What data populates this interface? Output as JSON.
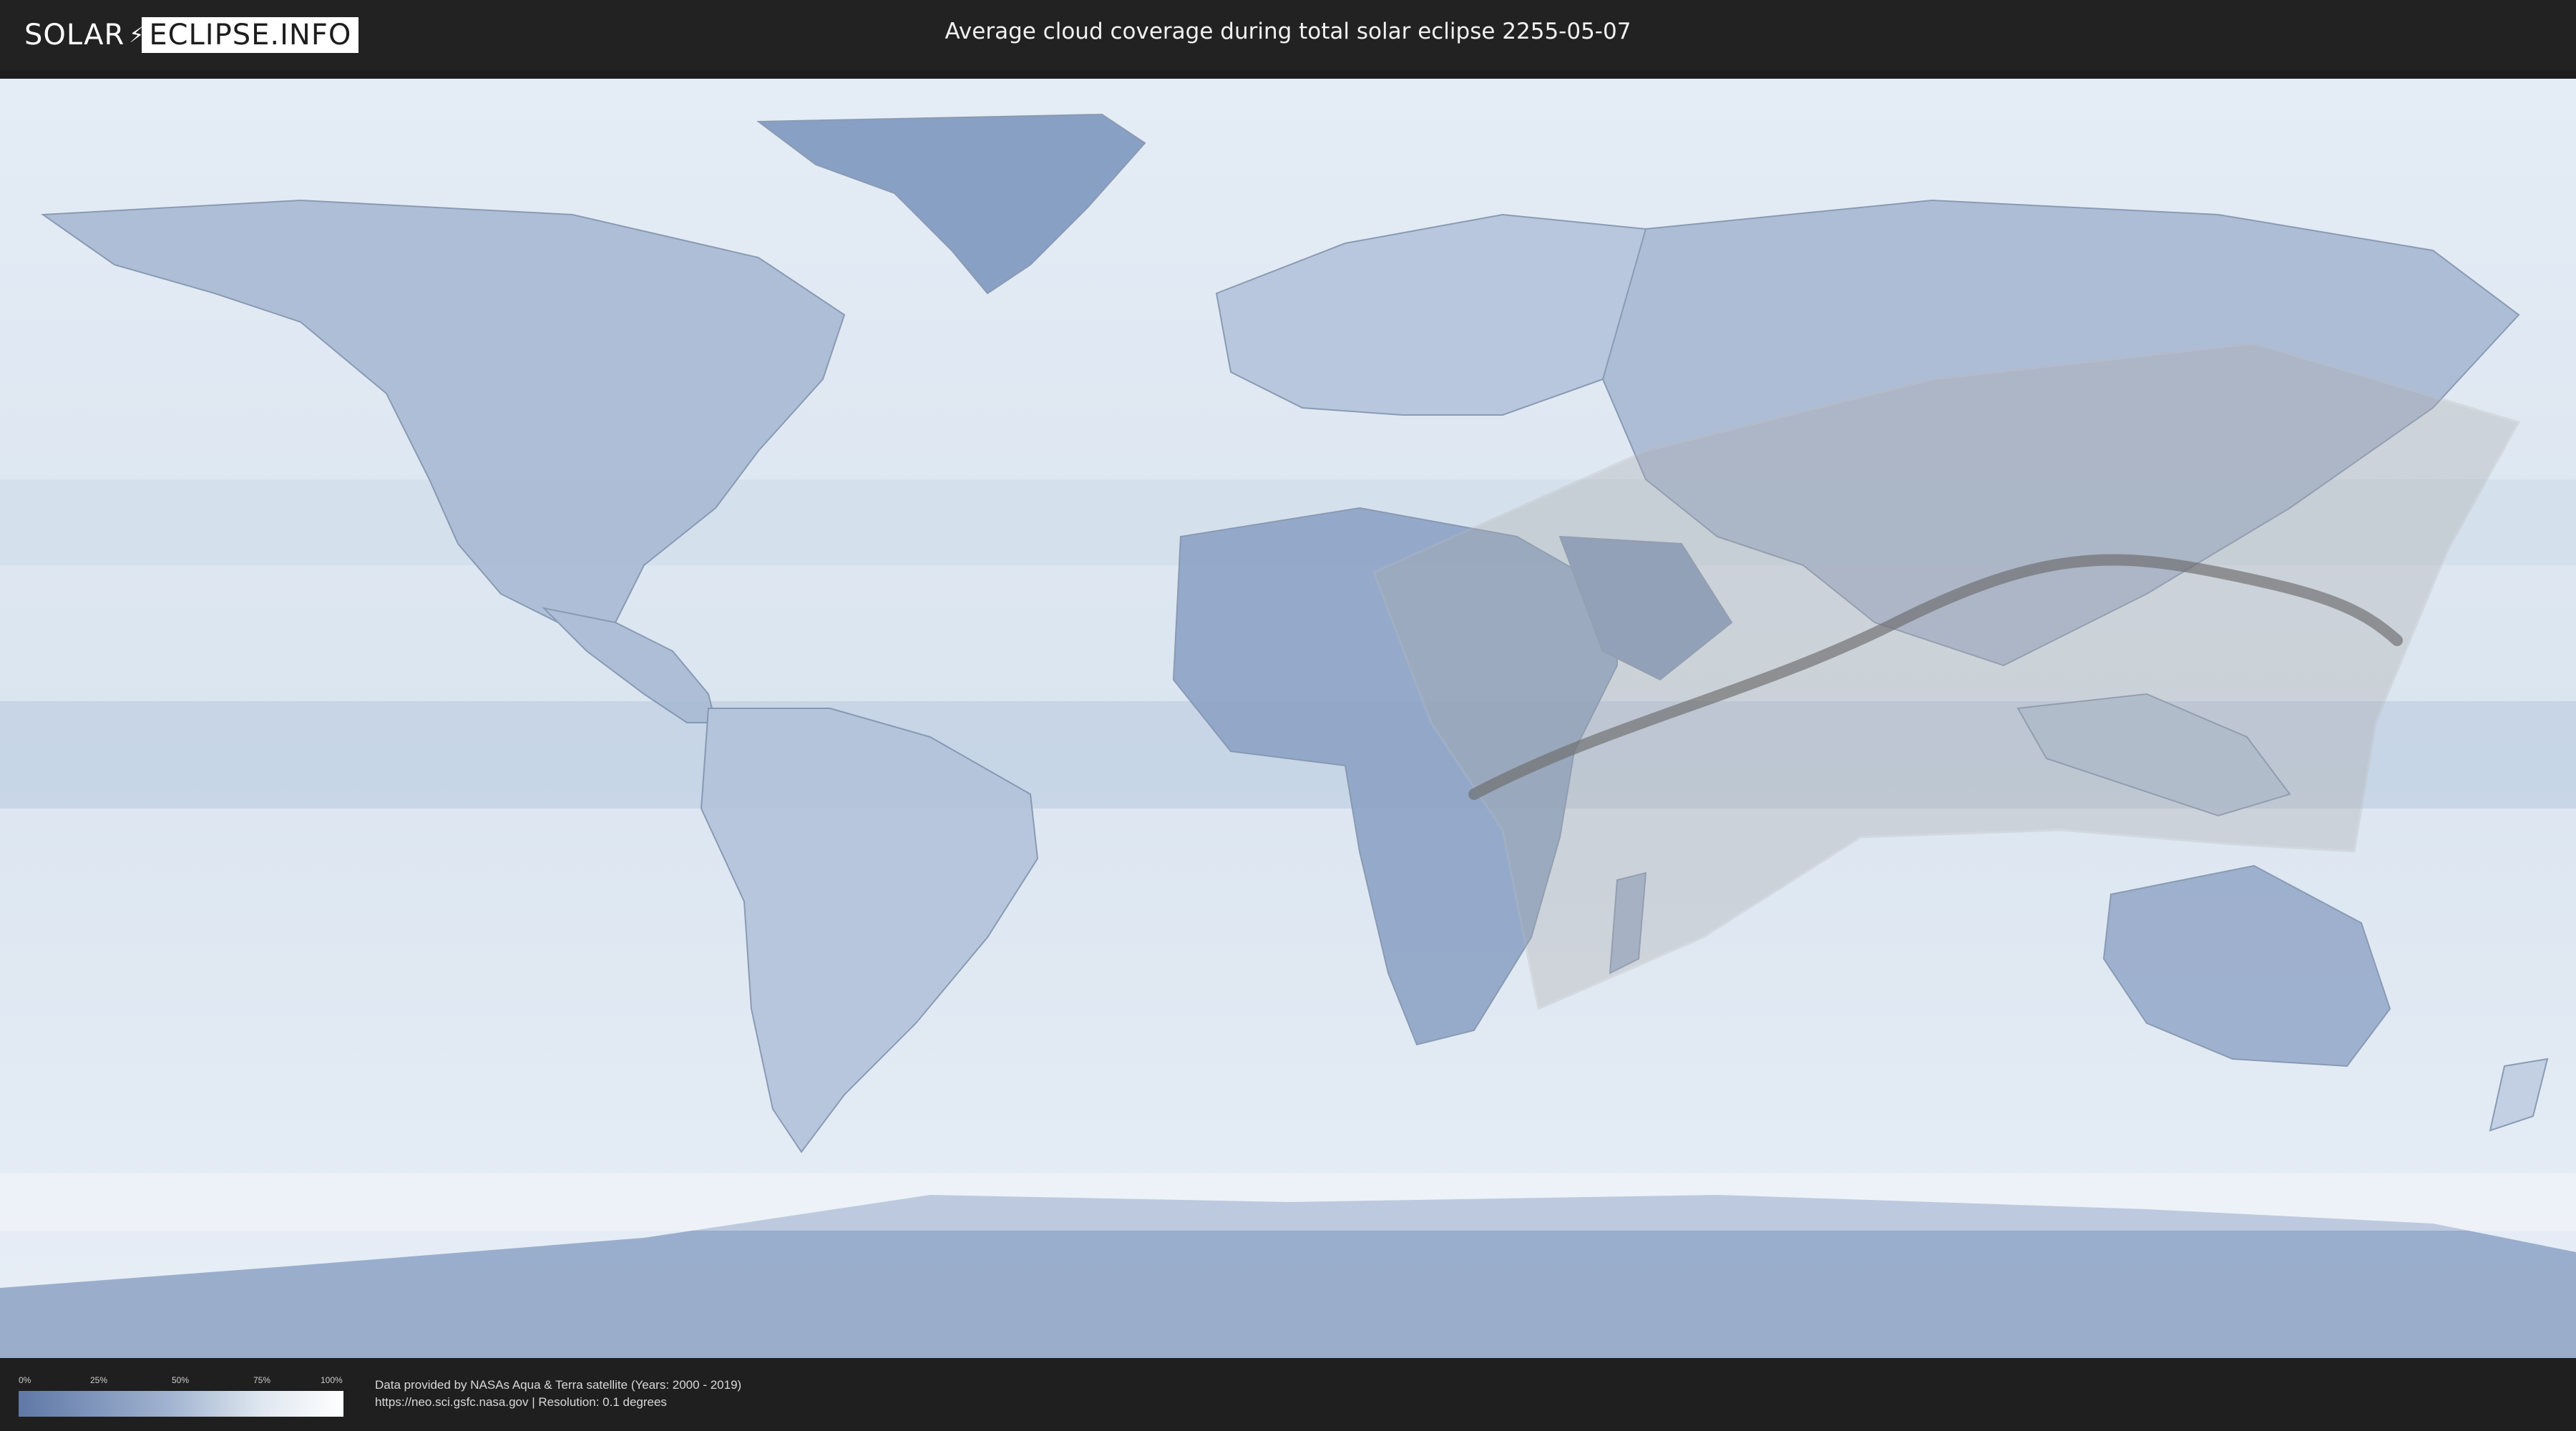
{
  "header": {
    "logo_left": "SOLAR",
    "logo_right": "ECLIPSE.INFO",
    "title": "Average cloud coverage during total solar eclipse 2255-05-07"
  },
  "map": {
    "eclipse_date": "2255-05-07",
    "region_fill_color": "#aaaaaa",
    "central_line_color": "#6c6c6c",
    "low_cloud_color": "#5f78a6",
    "high_cloud_color": "#ffffff"
  },
  "legend": {
    "ticks": [
      "0%",
      "25%",
      "50%",
      "75%",
      "100%"
    ]
  },
  "credits": {
    "line1": "Data provided by NASAs Aqua & Terra satellite (Years: 2000 - 2019)",
    "line2": "https://neo.sci.gsfc.nasa.gov | Resolution: 0.1 degrees"
  }
}
